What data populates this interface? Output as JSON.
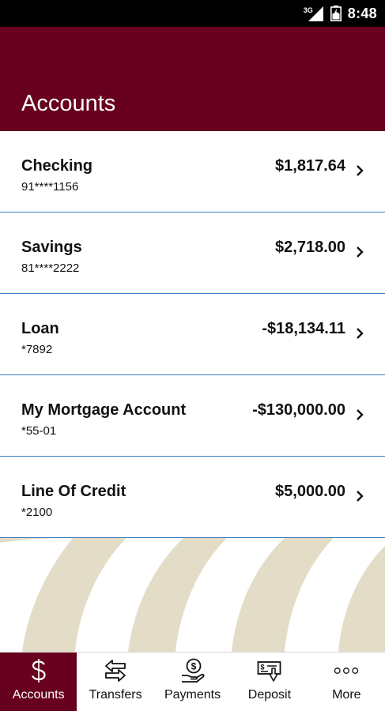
{
  "status_bar": {
    "network": "3G",
    "time": "8:48"
  },
  "header": {
    "title": "Accounts"
  },
  "accounts": [
    {
      "name": "Checking",
      "number": "91****1156",
      "balance": "$1,817.64"
    },
    {
      "name": "Savings",
      "number": "81****2222",
      "balance": "$2,718.00"
    },
    {
      "name": "Loan",
      "number": "*7892",
      "balance": "-$18,134.11"
    },
    {
      "name": "My Mortgage Account",
      "number": "*55-01",
      "balance": "-$130,000.00"
    },
    {
      "name": "Line Of Credit",
      "number": "*2100",
      "balance": "$5,000.00"
    }
  ],
  "nav": {
    "items": [
      {
        "label": "Accounts",
        "icon": "dollar-icon",
        "active": true
      },
      {
        "label": "Transfers",
        "icon": "transfer-arrows-icon"
      },
      {
        "label": "Payments",
        "icon": "payment-hand-icon"
      },
      {
        "label": "Deposit",
        "icon": "check-deposit-icon"
      },
      {
        "label": "More",
        "icon": "more-dots-icon"
      }
    ]
  },
  "colors": {
    "brand": "#68001f",
    "divider": "#3b7dc4",
    "decor": "#e3ddc8"
  }
}
